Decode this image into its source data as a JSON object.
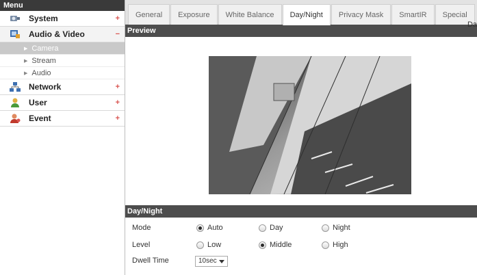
{
  "sidebar": {
    "title": "Menu",
    "items": [
      {
        "label": "System",
        "toggle": "+",
        "icon": "system-icon"
      },
      {
        "label": "Audio & Video",
        "toggle": "−",
        "icon": "audio-video-icon"
      },
      {
        "label": "Network",
        "toggle": "+",
        "icon": "network-icon"
      },
      {
        "label": "User",
        "toggle": "+",
        "icon": "user-icon"
      },
      {
        "label": "Event",
        "toggle": "+",
        "icon": "event-icon"
      }
    ],
    "sub_items": [
      {
        "label": "Camera",
        "active": true
      },
      {
        "label": "Stream",
        "active": false
      },
      {
        "label": "Audio",
        "active": false
      }
    ]
  },
  "tabs": [
    "General",
    "Exposure",
    "White Balance",
    "Day/Night",
    "Privacy Mask",
    "SmartIR",
    "Special"
  ],
  "active_tab": "Day/Night",
  "tab_overflow_text": "Da",
  "preview": {
    "title": "Preview"
  },
  "day_night": {
    "title": "Day/Night",
    "mode": {
      "label": "Mode",
      "options": [
        "Auto",
        "Day",
        "Night"
      ],
      "selected": "Auto"
    },
    "level": {
      "label": "Level",
      "options": [
        "Low",
        "Middle",
        "High"
      ],
      "selected": "Middle"
    },
    "dwell_time": {
      "label": "Dwell Time",
      "value": "10sec"
    }
  },
  "colors": {
    "header_bg": "#4d4d4d",
    "toggle": "#d9534f",
    "active_sub_bg": "#c9c9c9"
  }
}
